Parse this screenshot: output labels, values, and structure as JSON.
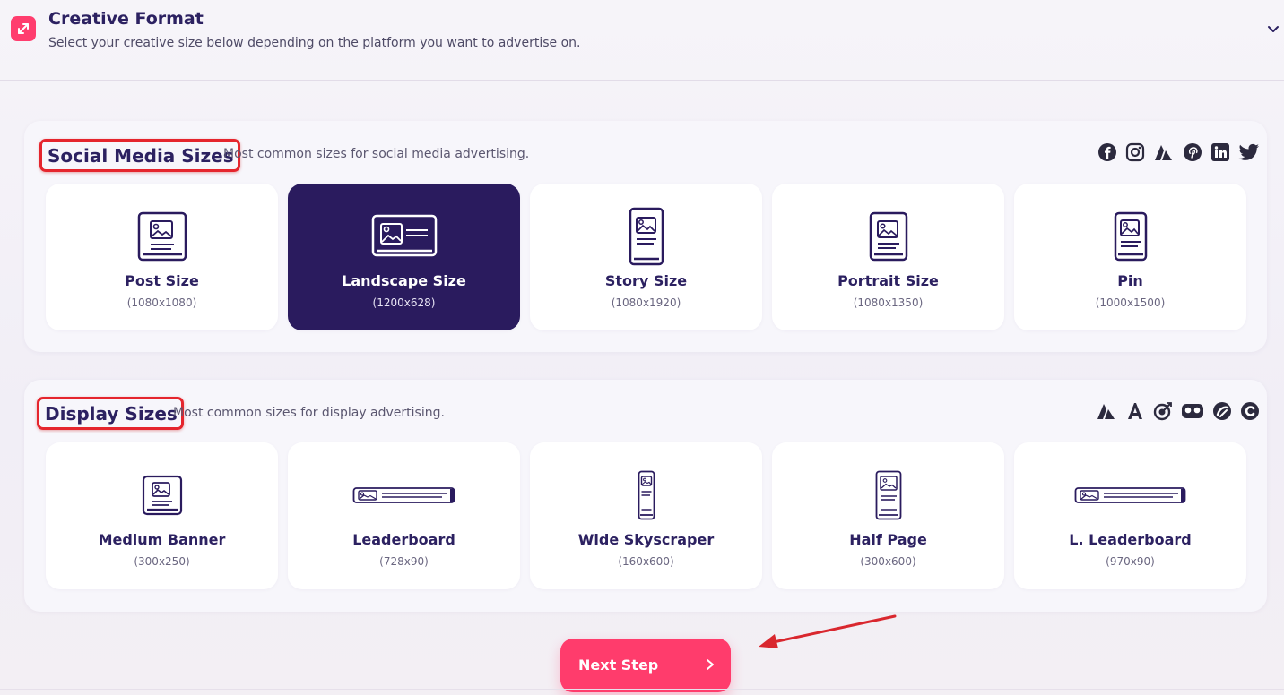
{
  "header": {
    "title": "Creative Format",
    "subtitle": "Select your creative size below depending on the platform you want to advertise on."
  },
  "social": {
    "title": "Social Media Sizes",
    "description": "Most common sizes for social media advertising.",
    "platforms": [
      "facebook-icon",
      "instagram-icon",
      "adroll-icon",
      "pinterest-icon",
      "linkedin-icon",
      "twitter-icon"
    ],
    "cards": [
      {
        "label": "Post Size",
        "dims": "(1080x1080)",
        "icon": "square-post-icon",
        "selected": false
      },
      {
        "label": "Landscape Size",
        "dims": "(1200x628)",
        "icon": "landscape-icon",
        "selected": true
      },
      {
        "label": "Story Size",
        "dims": "(1080x1920)",
        "icon": "story-icon",
        "selected": false
      },
      {
        "label": "Portrait Size",
        "dims": "(1080x1350)",
        "icon": "portrait-icon",
        "selected": false
      },
      {
        "label": "Pin",
        "dims": "(1000x1500)",
        "icon": "pin-icon",
        "selected": false
      }
    ]
  },
  "display": {
    "title": "Display Sizes",
    "description": "Most common sizes for display advertising.",
    "platforms": [
      "adroll-icon",
      "google-ads-icon",
      "target-icon",
      "criteo-icon",
      "taboola-icon",
      "c-icon"
    ],
    "cards": [
      {
        "label": "Medium Banner",
        "dims": "(300x250)",
        "icon": "medium-banner-icon"
      },
      {
        "label": "Leaderboard",
        "dims": "(728x90)",
        "icon": "leaderboard-icon"
      },
      {
        "label": "Wide Skyscraper",
        "dims": "(160x600)",
        "icon": "skyscraper-icon"
      },
      {
        "label": "Half Page",
        "dims": "(300x600)",
        "icon": "half-page-icon"
      },
      {
        "label": "L. Leaderboard",
        "dims": "(970x90)",
        "icon": "large-leaderboard-icon"
      }
    ]
  },
  "next_button": {
    "label": "Next Step"
  },
  "colors": {
    "accent": "#ff3c6c",
    "selected_card": "#2a1b5e",
    "title_text": "#2c2161",
    "highlight_box": "#e5252d"
  }
}
